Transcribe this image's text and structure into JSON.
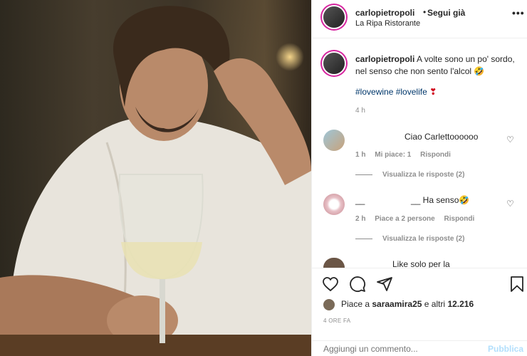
{
  "post": {
    "username": "carlopietropoli",
    "follow_separator": "•",
    "follow_label": "Segui già",
    "location": "La Ripa Ristorante",
    "more_icon": "more-options-icon"
  },
  "caption": {
    "username": "carlopietropoli",
    "text": "A volte sono un po' sordo, nel senso che non sento l'alcol 🤣",
    "tags": [
      "#lovewine",
      "#lovelife"
    ],
    "emoji": "❣",
    "time": "4 h"
  },
  "comments": [
    {
      "text": "Ciao Carlettoooooo",
      "time": "1 h",
      "likes": "Mi piace: 1",
      "reply": "Rispondi",
      "view_replies": "Visualizza le risposte (2)"
    },
    {
      "prefix": "__",
      "text": "__ Ha senso🤣",
      "time": "2 h",
      "likes": "Piace a 2 persone",
      "reply": "Rispondi",
      "view_replies": "Visualizza le risposte (2)"
    },
    {
      "text": "Like solo per la"
    }
  ],
  "actions": {
    "likes_prefix": "Piace a ",
    "likes_user": "saraamira25",
    "likes_suffix": " e altri ",
    "likes_count": "12.216",
    "time": "4 ORE FA"
  },
  "comment_box": {
    "placeholder": "Aggiungi un commento...",
    "publish": "Pubblica"
  },
  "colors": {
    "link": "#00376b",
    "muted": "#8e8e8e",
    "publish_disabled": "#b2dffc"
  }
}
